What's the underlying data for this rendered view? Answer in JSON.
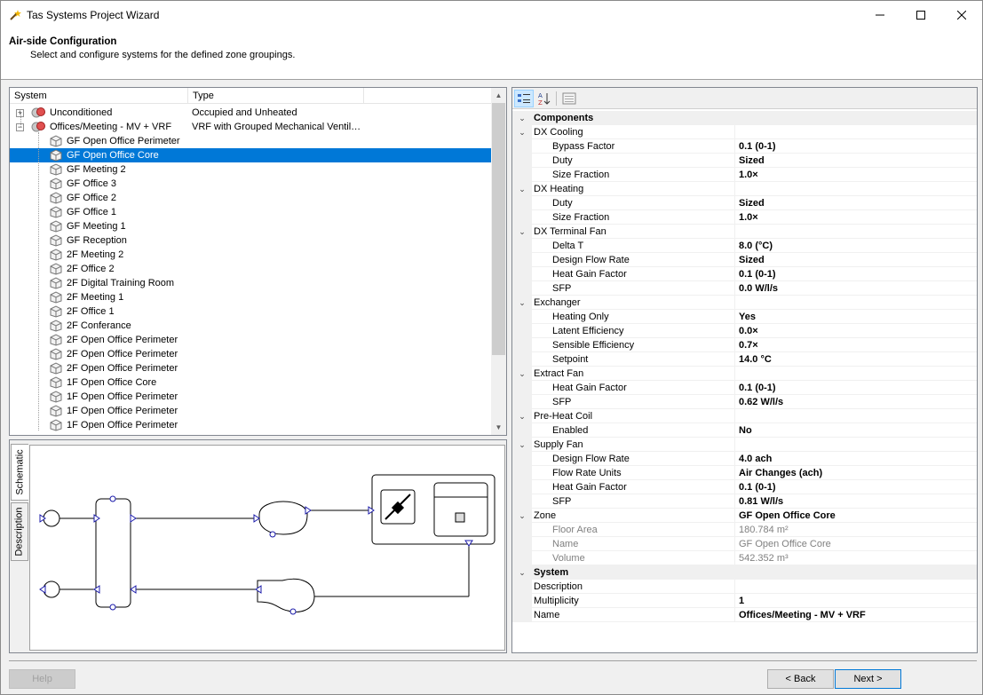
{
  "window": {
    "title": "Tas Systems Project Wizard",
    "icon": "wand-icon"
  },
  "header": {
    "title": "Air-side Configuration",
    "subtitle": "Select and configure systems for the defined zone groupings."
  },
  "tree": {
    "columns": [
      "System",
      "Type"
    ],
    "groups": [
      {
        "label": "Unconditioned",
        "type": "Occupied and Unheated",
        "expanded": false
      },
      {
        "label": "Offices/Meeting - MV + VRF",
        "type": "VRF  with  Grouped  Mechanical Ventil…",
        "expanded": true
      }
    ],
    "zones": [
      "GF Open Office Perimeter",
      "GF Open Office Core",
      "GF Meeting 2",
      "GF Office 3",
      "GF Office 2",
      "GF Office 1",
      "GF Meeting 1",
      "GF Reception",
      "2F Meeting 2",
      "2F Office 2",
      "2F Digital Training Room",
      "2F Meeting 1",
      "2F Office 1",
      "2F Conferance",
      "2F Open Office Perimeter",
      "2F Open Office Perimeter",
      "2F Open Office Perimeter",
      "1F Open Office Core",
      "1F Open Office Perimeter",
      "1F Open Office Perimeter",
      "1F Open Office Perimeter"
    ],
    "selected": "GF Open Office Core"
  },
  "tabs": {
    "schematic": "Schematic",
    "description": "Description"
  },
  "properties": {
    "rows": [
      {
        "kind": "cat",
        "name": "Components"
      },
      {
        "kind": "sub",
        "name": "DX Cooling"
      },
      {
        "kind": "prop",
        "name": "Bypass Factor",
        "value": "0.1 (0-1)"
      },
      {
        "kind": "prop",
        "name": "Duty",
        "value": "Sized"
      },
      {
        "kind": "prop",
        "name": "Size Fraction",
        "value": "1.0×"
      },
      {
        "kind": "sub",
        "name": "DX Heating"
      },
      {
        "kind": "prop",
        "name": "Duty",
        "value": "Sized"
      },
      {
        "kind": "prop",
        "name": "Size Fraction",
        "value": "1.0×"
      },
      {
        "kind": "sub",
        "name": "DX Terminal Fan"
      },
      {
        "kind": "prop",
        "name": "Delta T",
        "value": "8.0 (°C)"
      },
      {
        "kind": "prop",
        "name": "Design Flow Rate",
        "value": "Sized"
      },
      {
        "kind": "prop",
        "name": "Heat Gain Factor",
        "value": "0.1 (0-1)"
      },
      {
        "kind": "prop",
        "name": "SFP",
        "value": "0.0 W/l/s"
      },
      {
        "kind": "sub",
        "name": "Exchanger"
      },
      {
        "kind": "prop",
        "name": "Heating Only",
        "value": "Yes"
      },
      {
        "kind": "prop",
        "name": "Latent Efficiency",
        "value": "0.0×"
      },
      {
        "kind": "prop",
        "name": "Sensible Efficiency",
        "value": "0.7×"
      },
      {
        "kind": "prop",
        "name": "Setpoint",
        "value": "14.0 °C"
      },
      {
        "kind": "sub",
        "name": "Extract Fan"
      },
      {
        "kind": "prop",
        "name": "Heat Gain Factor",
        "value": "0.1 (0-1)"
      },
      {
        "kind": "prop",
        "name": "SFP",
        "value": "0.62 W/l/s"
      },
      {
        "kind": "sub",
        "name": "Pre-Heat Coil"
      },
      {
        "kind": "prop",
        "name": "Enabled",
        "value": "No"
      },
      {
        "kind": "sub",
        "name": "Supply Fan"
      },
      {
        "kind": "prop",
        "name": "Design Flow Rate",
        "value": "4.0 ach"
      },
      {
        "kind": "prop",
        "name": "Flow Rate Units",
        "value": "Air Changes (ach)"
      },
      {
        "kind": "prop",
        "name": "Heat Gain Factor",
        "value": "0.1 (0-1)"
      },
      {
        "kind": "prop",
        "name": "SFP",
        "value": "0.81 W/l/s"
      },
      {
        "kind": "sub",
        "name": "Zone",
        "value": "GF Open Office Core"
      },
      {
        "kind": "ro",
        "name": "Floor Area",
        "value": "180.784 m²"
      },
      {
        "kind": "ro",
        "name": "Name",
        "value": "GF Open Office Core"
      },
      {
        "kind": "ro",
        "name": "Volume",
        "value": "542.352 m³"
      },
      {
        "kind": "cat",
        "name": "System"
      },
      {
        "kind": "top",
        "name": "Description",
        "value": ""
      },
      {
        "kind": "top",
        "name": "Multiplicity",
        "value": "1"
      },
      {
        "kind": "top",
        "name": "Name",
        "value": "Offices/Meeting - MV + VRF"
      }
    ]
  },
  "buttons": {
    "help": "Help",
    "back": "< Back",
    "next": "Next >"
  }
}
